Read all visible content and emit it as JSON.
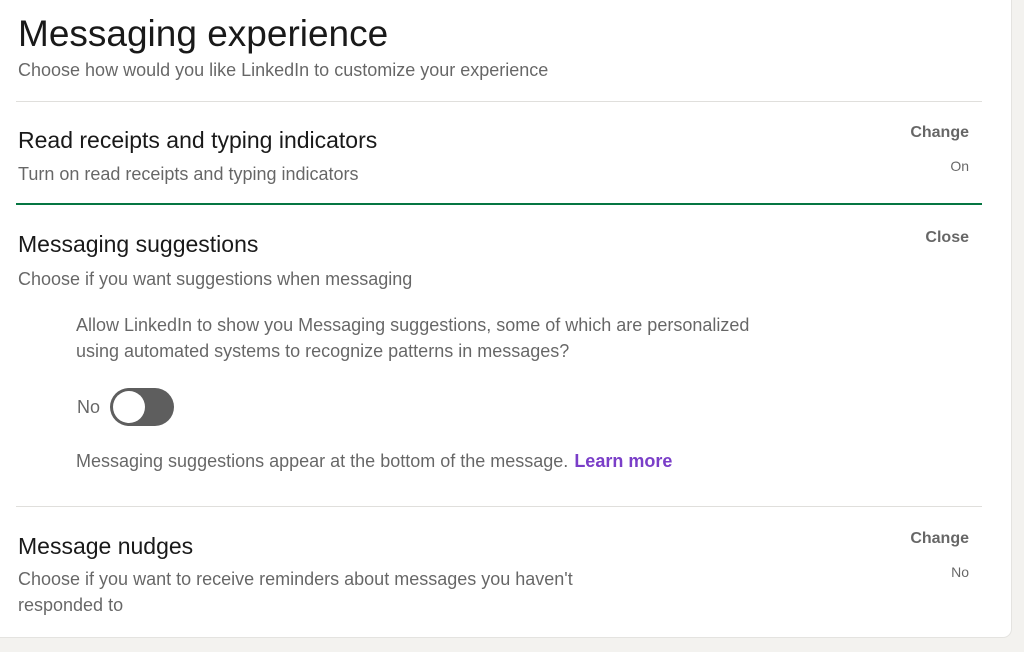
{
  "page": {
    "title": "Messaging experience",
    "subtitle": "Choose how would you like LinkedIn to customize your experience"
  },
  "sections": {
    "read_receipts": {
      "title": "Read receipts and typing indicators",
      "description": "Turn on read receipts and typing indicators",
      "action_label": "Change",
      "status": "On"
    },
    "messaging_suggestions": {
      "title": "Messaging suggestions",
      "description": "Choose if you want suggestions when messaging",
      "action_label": "Close",
      "question": "Allow LinkedIn to show you Messaging suggestions, some of which are personalized using automated systems to recognize patterns in messages?",
      "toggle_label": "No",
      "toggle_on": false,
      "hint": "Messaging suggestions appear at the bottom of the message.",
      "learn_more": "Learn more"
    },
    "message_nudges": {
      "title": "Message nudges",
      "description": "Choose if you want to receive reminders about messages you haven't responded to",
      "action_label": "Change",
      "status": "No"
    }
  },
  "colors": {
    "active_divider": "#057642",
    "link": "#7a3ec8",
    "toggle_off": "#5e5e5e"
  }
}
